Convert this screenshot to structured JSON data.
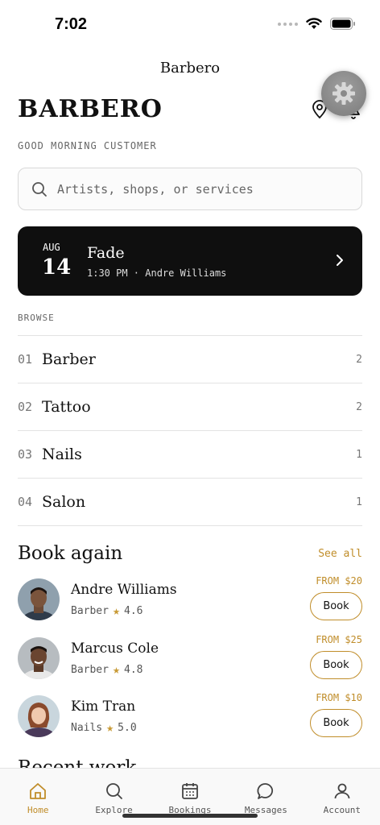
{
  "status_bar": {
    "time": "7:02"
  },
  "nav": {
    "title": "Barbero"
  },
  "header": {
    "brand": "BARBERO",
    "greeting": "GOOD MORNING CUSTOMER"
  },
  "search": {
    "placeholder": "Artists, shops, or services"
  },
  "appointment": {
    "month": "AUG",
    "day": "14",
    "service": "Fade",
    "meta": "1:30 PM · Andre Williams"
  },
  "browse": {
    "label": "BROWSE",
    "items": [
      {
        "num": "01",
        "name": "Barber",
        "count": "2"
      },
      {
        "num": "02",
        "name": "Tattoo",
        "count": "2"
      },
      {
        "num": "03",
        "name": "Nails",
        "count": "1"
      },
      {
        "num": "04",
        "name": "Salon",
        "count": "1"
      }
    ]
  },
  "book_again": {
    "title": "Book again",
    "see_all": "See all",
    "book_label": "Book",
    "artists": [
      {
        "name": "Andre Williams",
        "category": "Barber",
        "rating": "4.6",
        "price": "FROM $20"
      },
      {
        "name": "Marcus Cole",
        "category": "Barber",
        "rating": "4.8",
        "price": "FROM $25"
      },
      {
        "name": "Kim Tran",
        "category": "Nails",
        "rating": "5.0",
        "price": "FROM $10"
      }
    ]
  },
  "recent": {
    "title": "Recent work"
  },
  "tabs": [
    {
      "label": "Home",
      "icon": "home-icon",
      "active": true
    },
    {
      "label": "Explore",
      "icon": "search-icon",
      "active": false
    },
    {
      "label": "Bookings",
      "icon": "calendar-icon",
      "active": false
    },
    {
      "label": "Messages",
      "icon": "message-icon",
      "active": false
    },
    {
      "label": "Account",
      "icon": "user-icon",
      "active": false
    }
  ],
  "colors": {
    "accent": "#c08d2a",
    "card": "#0f0f0f",
    "star": "#c89a35"
  }
}
